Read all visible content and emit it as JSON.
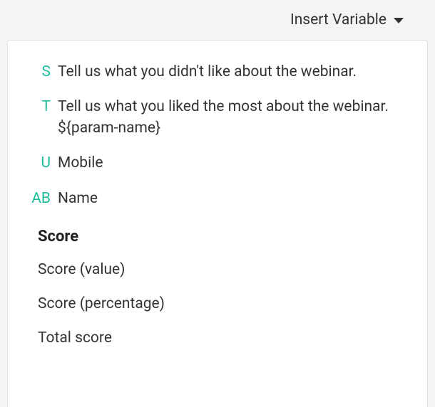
{
  "toolbar": {
    "insert_variable_label": "Insert Variable"
  },
  "dropdown": {
    "variables": [
      {
        "letter": "S",
        "text": "Tell us what you didn't like about the webinar.",
        "wide": false
      },
      {
        "letter": "T",
        "text": "Tell us what you liked the most about the webinar. ${param-name}",
        "wide": false
      },
      {
        "letter": "U",
        "text": "Mobile",
        "wide": false
      },
      {
        "letter": "AB",
        "text": "Name",
        "wide": true
      }
    ],
    "score_section_label": "Score",
    "score_items": [
      {
        "label": "Score (value)"
      },
      {
        "label": "Score (percentage)"
      },
      {
        "label": "Total score"
      }
    ]
  }
}
